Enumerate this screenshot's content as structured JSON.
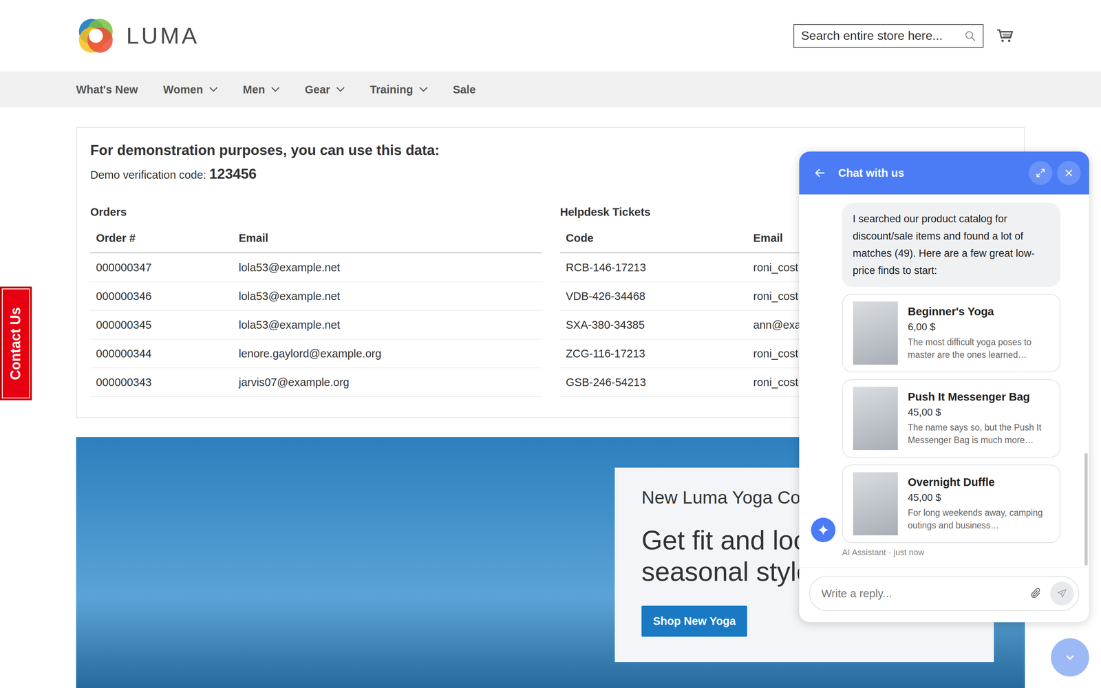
{
  "header": {
    "logo": "LUMA",
    "search_placeholder": "Search entire store here..."
  },
  "nav": [
    {
      "label": "What's New",
      "dropdown": false
    },
    {
      "label": "Women",
      "dropdown": true
    },
    {
      "label": "Men",
      "dropdown": true
    },
    {
      "label": "Gear",
      "dropdown": true
    },
    {
      "label": "Training",
      "dropdown": true
    },
    {
      "label": "Sale",
      "dropdown": false
    }
  ],
  "demo": {
    "title": "For demonstration purposes, you can use this data:",
    "code_label": "Demo verification code:",
    "code": "123456",
    "orders": {
      "title": "Orders",
      "columns": [
        "Order #",
        "Email"
      ],
      "rows": [
        [
          "000000347",
          "lola53@example.net"
        ],
        [
          "000000346",
          "lola53@example.net"
        ],
        [
          "000000345",
          "lola53@example.net"
        ],
        [
          "000000344",
          "lenore.gaylord@example.org"
        ],
        [
          "000000343",
          "jarvis07@example.org"
        ]
      ]
    },
    "tickets": {
      "title": "Helpdesk Tickets",
      "columns": [
        "Code",
        "Email"
      ],
      "rows": [
        [
          "RCB-146-17213",
          "roni_cost@"
        ],
        [
          "VDB-426-34468",
          "roni_cost@"
        ],
        [
          "SXA-380-34385",
          "ann@exam"
        ],
        [
          "ZCG-116-17213",
          "roni_cost@"
        ],
        [
          "GSB-246-54213",
          "roni_cost@"
        ]
      ]
    }
  },
  "contact_tab": "Contact Us",
  "hero": {
    "eyebrow": "New Luma Yoga Colle",
    "headline_lines": [
      "Get fit and loo",
      "seasonal styles"
    ],
    "button": "Shop New Yoga"
  },
  "chat": {
    "title": "Chat with us",
    "message": "I searched our product catalog for discount/sale items and found a lot of matches (49). Here are a few great low-price finds to start:",
    "products": [
      {
        "name": "Beginner's Yoga",
        "price": "6,00 $",
        "description": "The most difficult yoga poses to master are the ones learned…"
      },
      {
        "name": "Push It Messenger Bag",
        "price": "45,00 $",
        "description": "The name says so, but the Push It Messenger Bag is much more…"
      },
      {
        "name": "Overnight Duffle",
        "price": "45,00 $",
        "description": "For long weekends away, camping outings and business…"
      }
    ],
    "caption": "AI Assistant · just now",
    "input_placeholder": "Write a reply..."
  }
}
